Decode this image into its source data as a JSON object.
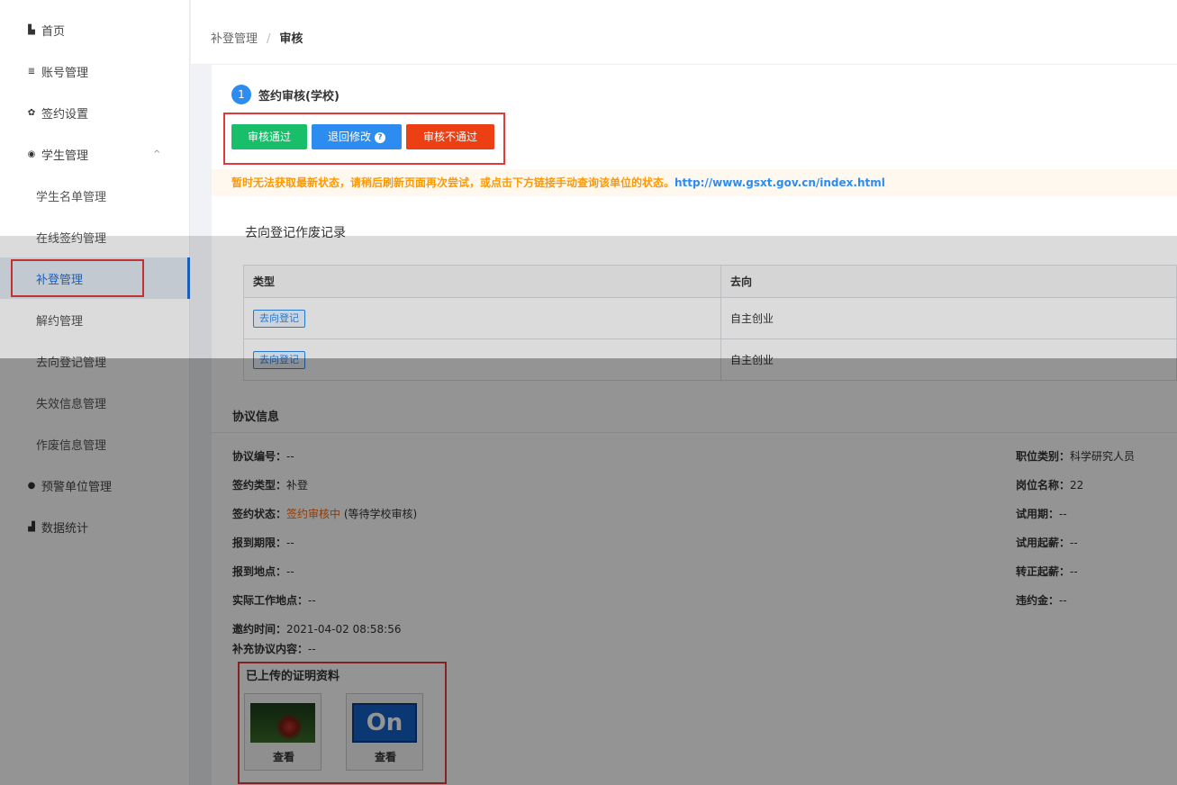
{
  "sidebar": {
    "items": [
      {
        "icon": "home-icon",
        "glyph": "▙",
        "label": "首页"
      },
      {
        "icon": "list-icon",
        "glyph": "≣",
        "label": "账号管理"
      },
      {
        "icon": "gear-icon",
        "glyph": "✿",
        "label": "签约设置"
      },
      {
        "icon": "student-icon",
        "glyph": "◉",
        "label": "学生管理"
      },
      {
        "label": "学生名单管理"
      },
      {
        "label": "在线签约管理"
      },
      {
        "label": "补登管理"
      },
      {
        "label": "解约管理"
      },
      {
        "label": "去向登记管理"
      },
      {
        "label": "失效信息管理"
      },
      {
        "label": "作废信息管理"
      },
      {
        "icon": "warning-dot-icon",
        "glyph": "●",
        "label": "预警单位管理"
      },
      {
        "icon": "bar-chart-icon",
        "glyph": "▟",
        "label": "数据统计"
      }
    ],
    "chevron": "^"
  },
  "breadcrumb": {
    "parent": "补登管理",
    "sep": "/",
    "current": "审核"
  },
  "step": {
    "number": "1",
    "title": "签约审核(学校)"
  },
  "actions": {
    "approve": "审核通过",
    "return": "退回修改",
    "help": "?",
    "reject": "审核不通过"
  },
  "warning": {
    "text": "暂时无法获取最新状态，请稍后刷新页面再次尝试，或点击下方链接手动查询该单位的状态。",
    "link": "http://www.gsxt.gov.cn/index.html"
  },
  "records": {
    "title": "去向登记作废记录",
    "headers": [
      "类型",
      "去向"
    ],
    "rows": [
      {
        "type": "去向登记",
        "dest": "自主创业"
      },
      {
        "type": "去向登记",
        "dest": "自主创业"
      }
    ]
  },
  "agreement": {
    "title": "协议信息",
    "left": [
      {
        "k": "协议编号：",
        "v": "--"
      },
      {
        "k": "签约类型：",
        "v": "补登"
      },
      {
        "k": "签约状态：",
        "v": "签约审核中",
        "extra": " (等待学校审核)"
      },
      {
        "k": "报到期限：",
        "v": "--"
      },
      {
        "k": "报到地点：",
        "v": "--"
      },
      {
        "k": "实际工作地点：",
        "v": "--"
      },
      {
        "k": "邀约时间：",
        "v": "2021-04-02 08:58:56"
      },
      {
        "k": "补充协议内容：",
        "v": "--"
      }
    ],
    "right": [
      {
        "k": "职位类别：",
        "v": "科学研究人员"
      },
      {
        "k": "岗位名称：",
        "v": "22"
      },
      {
        "k": "试用期：",
        "v": "--"
      },
      {
        "k": "试用起薪：",
        "v": "--"
      },
      {
        "k": "转正起薪：",
        "v": "--"
      },
      {
        "k": "违约金：",
        "v": "--"
      }
    ]
  },
  "uploads": {
    "title": "已上传的证明资料",
    "files": [
      {
        "label": "查看"
      },
      {
        "label": "查看",
        "image_text": "On"
      }
    ]
  }
}
